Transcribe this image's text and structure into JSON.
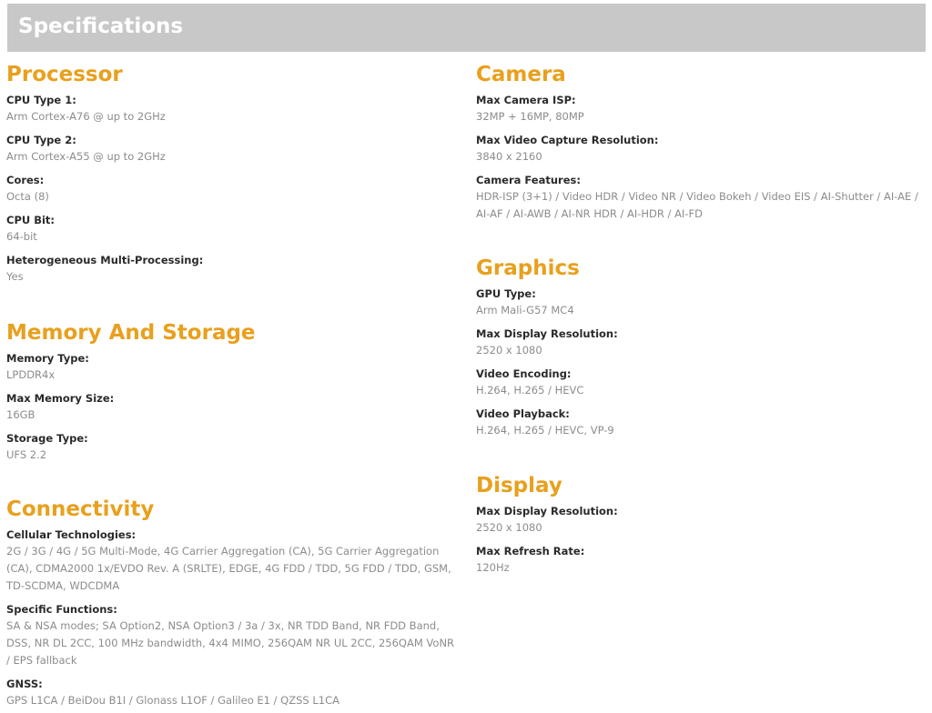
{
  "header": {
    "title": "Specifications"
  },
  "colors": {
    "accent": "#e8a01e",
    "header_bg": "#c8c8c8",
    "label": "#2a2a2a",
    "value": "#8c8c8c"
  },
  "processor": {
    "title": "Processor",
    "specs": [
      {
        "label": "CPU Type 1:",
        "value": "Arm Cortex-A76 @ up to 2GHz"
      },
      {
        "label": "CPU Type 2:",
        "value": "Arm Cortex-A55 @ up to 2GHz"
      },
      {
        "label": "Cores:",
        "value": "Octa (8)"
      },
      {
        "label": "CPU Bit:",
        "value": "64-bit"
      },
      {
        "label": "Heterogeneous Multi-Processing:",
        "value": "Yes"
      }
    ]
  },
  "memory": {
    "title": "Memory And Storage",
    "specs": [
      {
        "label": "Memory Type:",
        "value": "LPDDR4x"
      },
      {
        "label": "Max Memory Size:",
        "value": "16GB"
      },
      {
        "label": "Storage Type:",
        "value": "UFS 2.2"
      }
    ]
  },
  "connectivity": {
    "title": "Connectivity",
    "specs": [
      {
        "label": "Cellular Technologies:",
        "value": "2G / 3G / 4G / 5G Multi-Mode,  4G Carrier Aggregation (CA),  5G Carrier Aggregation (CA),  CDMA2000 1x/EVDO Rev. A (SRLTE),  EDGE,  4G FDD / TDD,  5G FDD / TDD,  GSM,  TD-SCDMA,  WDCDMA"
      },
      {
        "label": "Specific Functions:",
        "value": "SA & NSA modes; SA Option2, NSA Option3 / 3a / 3x, NR TDD Band, NR FDD Band, DSS, NR DL 2CC, 100 MHz bandwidth, 4x4 MIMO, 256QAM NR UL 2CC, 256QAM VoNR / EPS fallback"
      },
      {
        "label": "GNSS:",
        "value": "GPS L1CA / BeiDou B1I / Glonass L1OF / Galileo E1 / QZSS L1CA"
      }
    ]
  },
  "camera": {
    "title": "Camera",
    "specs": [
      {
        "label": "Max Camera ISP:",
        "value": "32MP + 16MP,  80MP"
      },
      {
        "label": "Max Video Capture Resolution:",
        "value": "3840 x 2160"
      },
      {
        "label": "Camera Features:",
        "value": "HDR-ISP (3+1) / Video HDR / Video NR / Video Bokeh / Video EIS / AI-Shutter / AI-AE / AI-AF / AI-AWB / AI-NR HDR / AI-HDR / AI-FD"
      }
    ]
  },
  "graphics": {
    "title": "Graphics",
    "specs": [
      {
        "label": "GPU Type:",
        "value": "Arm Mali-G57 MC4"
      },
      {
        "label": "Max Display Resolution:",
        "value": "2520 x 1080"
      },
      {
        "label": "Video Encoding:",
        "value": "H.264,  H.265 / HEVC"
      },
      {
        "label": "Video Playback:",
        "value": "H.264,  H.265 / HEVC,  VP-9"
      }
    ]
  },
  "display": {
    "title": "Display",
    "specs": [
      {
        "label": "Max Display Resolution:",
        "value": "2520 x 1080"
      },
      {
        "label": "Max Refresh Rate:",
        "value": "120Hz"
      }
    ]
  }
}
